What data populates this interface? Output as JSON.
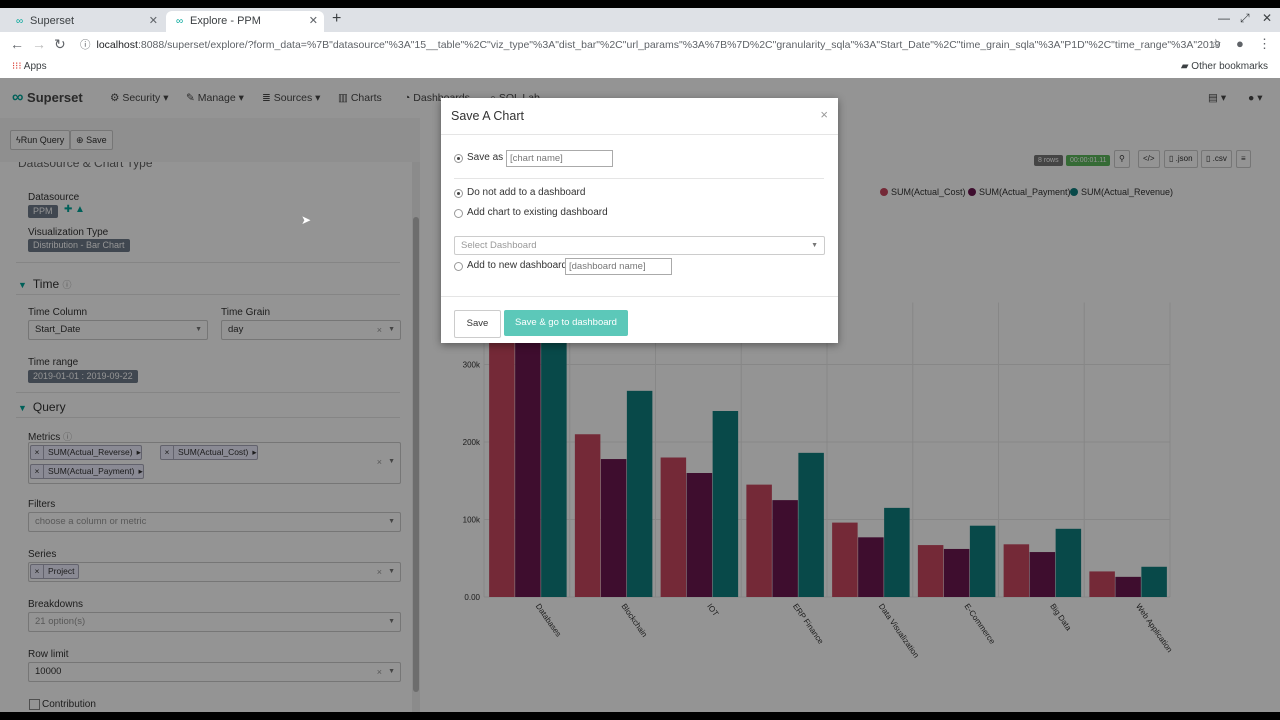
{
  "browser": {
    "tabs": [
      {
        "title": "Superset",
        "active": false
      },
      {
        "title": "Explore - PPM",
        "active": true
      }
    ],
    "url_host": "localhost",
    "url_rest": ":8088/superset/explore/?form_data=%7B\"datasource\"%3A\"15__table\"%2C\"viz_type\"%3A\"dist_bar\"%2C\"url_params\"%3A%7B%7D%2C\"granularity_sqla\"%3A\"Start_Date\"%2C\"time_grain_sqla\"%3A\"P1D\"%2C\"time_range\"%3A\"2019-01-01T00%...",
    "bookmarks": {
      "apps": "Apps",
      "other": "Other bookmarks"
    }
  },
  "nav": {
    "brand": "Superset",
    "items": [
      "Security",
      "Manage",
      "Sources",
      "Charts",
      "Dashboards",
      "SQL Lab"
    ]
  },
  "toolbar": {
    "run_query": "Run Query",
    "save": "Save"
  },
  "left": {
    "section_partial": "Datasource & Chart Type",
    "datasource_label": "Datasource",
    "datasource_value": "PPM",
    "viz_type_label": "Visualization Type",
    "viz_type_value": "Distribution - Bar Chart",
    "time_section": "Time",
    "time_column_label": "Time Column",
    "time_column_value": "Start_Date",
    "time_grain_label": "Time Grain",
    "time_grain_value": "day",
    "time_range_label": "Time range",
    "time_range_value": "2019-01-01 : 2019-09-22",
    "query_section": "Query",
    "metrics_label": "Metrics",
    "metrics": [
      "SUM(Actual_Reverse)",
      "SUM(Actual_Cost)",
      "SUM(Actual_Payment)"
    ],
    "filters_label": "Filters",
    "filters_placeholder": "choose a column or metric",
    "series_label": "Series",
    "series_value": "Project",
    "breakdowns_label": "Breakdowns",
    "breakdowns_placeholder": "21 option(s)",
    "row_limit_label": "Row limit",
    "row_limit_value": "10000",
    "contribution_label": "Contribution"
  },
  "right": {
    "rows_badge": "8 rows",
    "time_badge": "00:00:01.11",
    "json_btn": ".json",
    "csv_btn": ".csv"
  },
  "chart_data": {
    "type": "bar",
    "categories": [
      "Databases",
      "Blockchain",
      "IOT",
      "ERP Finance",
      "Data Visualization",
      "E-Commerce",
      "Big Data",
      "Web Application"
    ],
    "series": [
      {
        "name": "SUM(Actual_Cost)",
        "color": "#c9485f",
        "values": [
          340000,
          210000,
          180000,
          145000,
          96000,
          67000,
          68000,
          33000
        ]
      },
      {
        "name": "SUM(Actual_Payment)",
        "color": "#6b1750",
        "values": [
          340000,
          178000,
          160000,
          125000,
          77000,
          62000,
          58000,
          26000
        ]
      },
      {
        "name": "SUM(Actual_Revenue)",
        "color": "#0f7e7e",
        "values": [
          340000,
          266000,
          240000,
          186000,
          115000,
          92000,
          88000,
          39000
        ]
      }
    ],
    "yticks": [
      "0.00",
      "100k",
      "200k",
      "300k"
    ],
    "ylim": [
      0,
      380000
    ]
  },
  "modal": {
    "title": "Save A Chart",
    "close": "×",
    "save_as_label": "Save as",
    "chart_name_placeholder": "[chart name]",
    "no_dashboard_label": "Do not add to a dashboard",
    "existing_dashboard_label": "Add chart to existing dashboard",
    "select_dashboard_placeholder": "Select Dashboard",
    "new_dashboard_label": "Add to new dashboard",
    "dashboard_name_placeholder": "[dashboard name]",
    "save_button": "Save",
    "save_go_button": "Save & go to dashboard"
  }
}
